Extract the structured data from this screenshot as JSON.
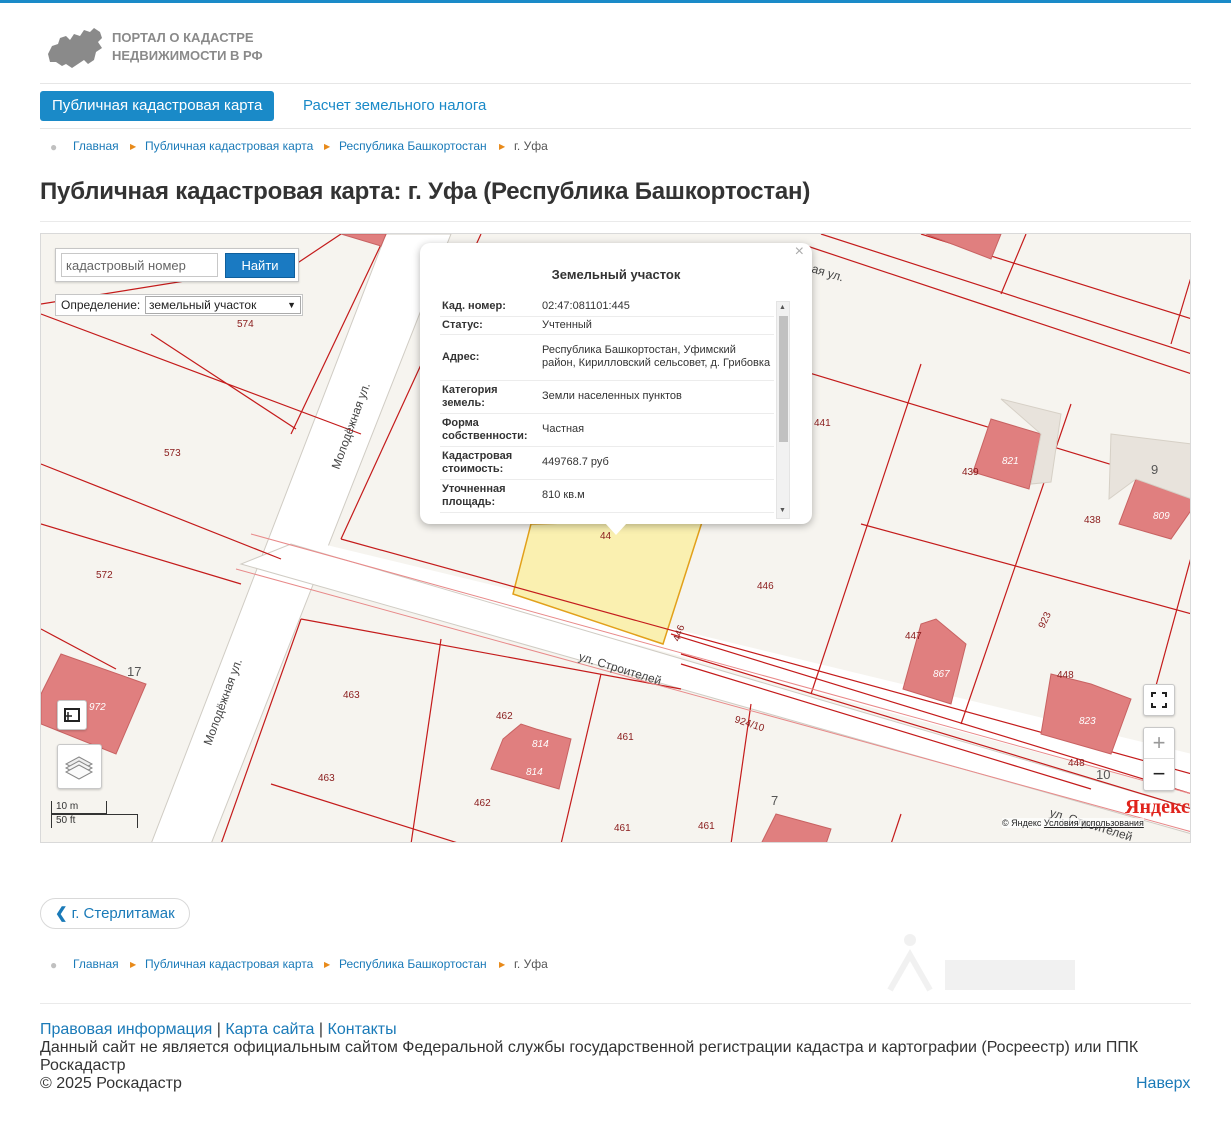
{
  "colors": {
    "accent": "#1a8ac8",
    "link": "#1a7ab8",
    "parcel_line": "#c41b1b",
    "building": "#e07f7f",
    "selected_parcel": "#faf0b0",
    "road": "#ffffff"
  },
  "header": {
    "logo_line1": "ПОРТАЛ О КАДАСТРЕ",
    "logo_line2": "НЕДВИЖИМОСТИ В РФ",
    "logo_icon": "russia-map-icon"
  },
  "nav": {
    "active": "Публичная кадастровая карта",
    "link": "Расчет земельного налога"
  },
  "breadcrumb": {
    "items": [
      "Главная",
      "Публичная кадастровая карта",
      "Республика Башкортостан"
    ],
    "current": "г. Уфа"
  },
  "page_title": "Публичная кадастровая карта: г. Уфа (Республика Башкортостан)",
  "map": {
    "search_placeholder": "кадастровый номер",
    "search_button": "Найти",
    "definition_label": "Определение:",
    "definition_value": "земельный участок",
    "street_labels": [
      "Молодёжная ул.",
      "Молодёжная ул.",
      "ул. Строителей",
      "ул. Строителей",
      "ая ул."
    ],
    "parcel_labels": [
      "574",
      "573",
      "572",
      "463",
      "463",
      "462",
      "462",
      "461",
      "461",
      "461",
      "441",
      "439",
      "438",
      "446",
      "446",
      "447",
      "448",
      "448",
      "923",
      "924/10",
      "44"
    ],
    "building_labels": [
      "972",
      "814",
      "814",
      "821",
      "809",
      "867",
      "823"
    ],
    "house_numbers": [
      "17",
      "9",
      "10",
      "7"
    ],
    "scale_m": "10 m",
    "scale_ft": "50 ft",
    "provider_logo": "Яндекс",
    "copyright": "© Яндекс",
    "terms": "Условия использования",
    "zoom_in": "+",
    "zoom_out": "−"
  },
  "popup": {
    "title": "Земельный участок",
    "close": "×",
    "rows": [
      {
        "key": "Кад. номер:",
        "value": "02:47:081101:445"
      },
      {
        "key": "Статус:",
        "value": "Учтенный"
      },
      {
        "key": "Адрес:",
        "value": "Республика Башкортостан, Уфимский район, Кирилловский сельсовет, д. Грибовка"
      },
      {
        "key": "Категория земель:",
        "value": "Земли населенных пунктов"
      },
      {
        "key": "Форма собственности:",
        "value": "Частная"
      },
      {
        "key": "Кадастровая стоимость:",
        "value": "449768.7 руб"
      },
      {
        "key": "Уточненная площадь:",
        "value": "810 кв.м"
      }
    ]
  },
  "back_link": "г. Стерлитамак",
  "footer": {
    "legal": "Правовая информация",
    "sitemap": "Карта сайта",
    "contacts": "Контакты",
    "separator": "|",
    "disclaimer": "Данный сайт не является официальным сайтом Федеральной службы государственной регистрации кадастра и картографии (Росреестр) или ППК Роскадастр",
    "copyright": "© 2025 Роскадастр",
    "to_top": "Наверх"
  }
}
